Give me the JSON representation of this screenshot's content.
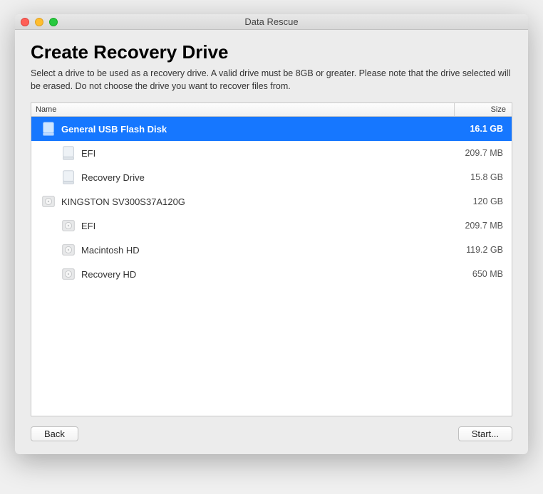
{
  "window": {
    "title": "Data Rescue"
  },
  "page": {
    "heading": "Create Recovery Drive",
    "description": "Select a drive to be used as a recovery drive. A valid drive must be 8GB or greater. Please note that the drive selected will be erased. Do not choose the drive you want to recover files from."
  },
  "columns": {
    "name": "Name",
    "size": "Size"
  },
  "drives": [
    {
      "name": "General USB Flash Disk",
      "size": "16.1 GB",
      "type": "external",
      "selected": true,
      "children": [
        {
          "name": "EFI",
          "size": "209.7 MB",
          "type": "external"
        },
        {
          "name": "Recovery Drive",
          "size": "15.8 GB",
          "type": "external"
        }
      ]
    },
    {
      "name": "KINGSTON SV300S37A120G",
      "size": "120 GB",
      "type": "internal",
      "selected": false,
      "children": [
        {
          "name": "EFI",
          "size": "209.7 MB",
          "type": "internal"
        },
        {
          "name": "Macintosh HD",
          "size": "119.2 GB",
          "type": "internal"
        },
        {
          "name": "Recovery HD",
          "size": "650 MB",
          "type": "internal"
        }
      ]
    }
  ],
  "buttons": {
    "back": "Back",
    "start": "Start..."
  }
}
